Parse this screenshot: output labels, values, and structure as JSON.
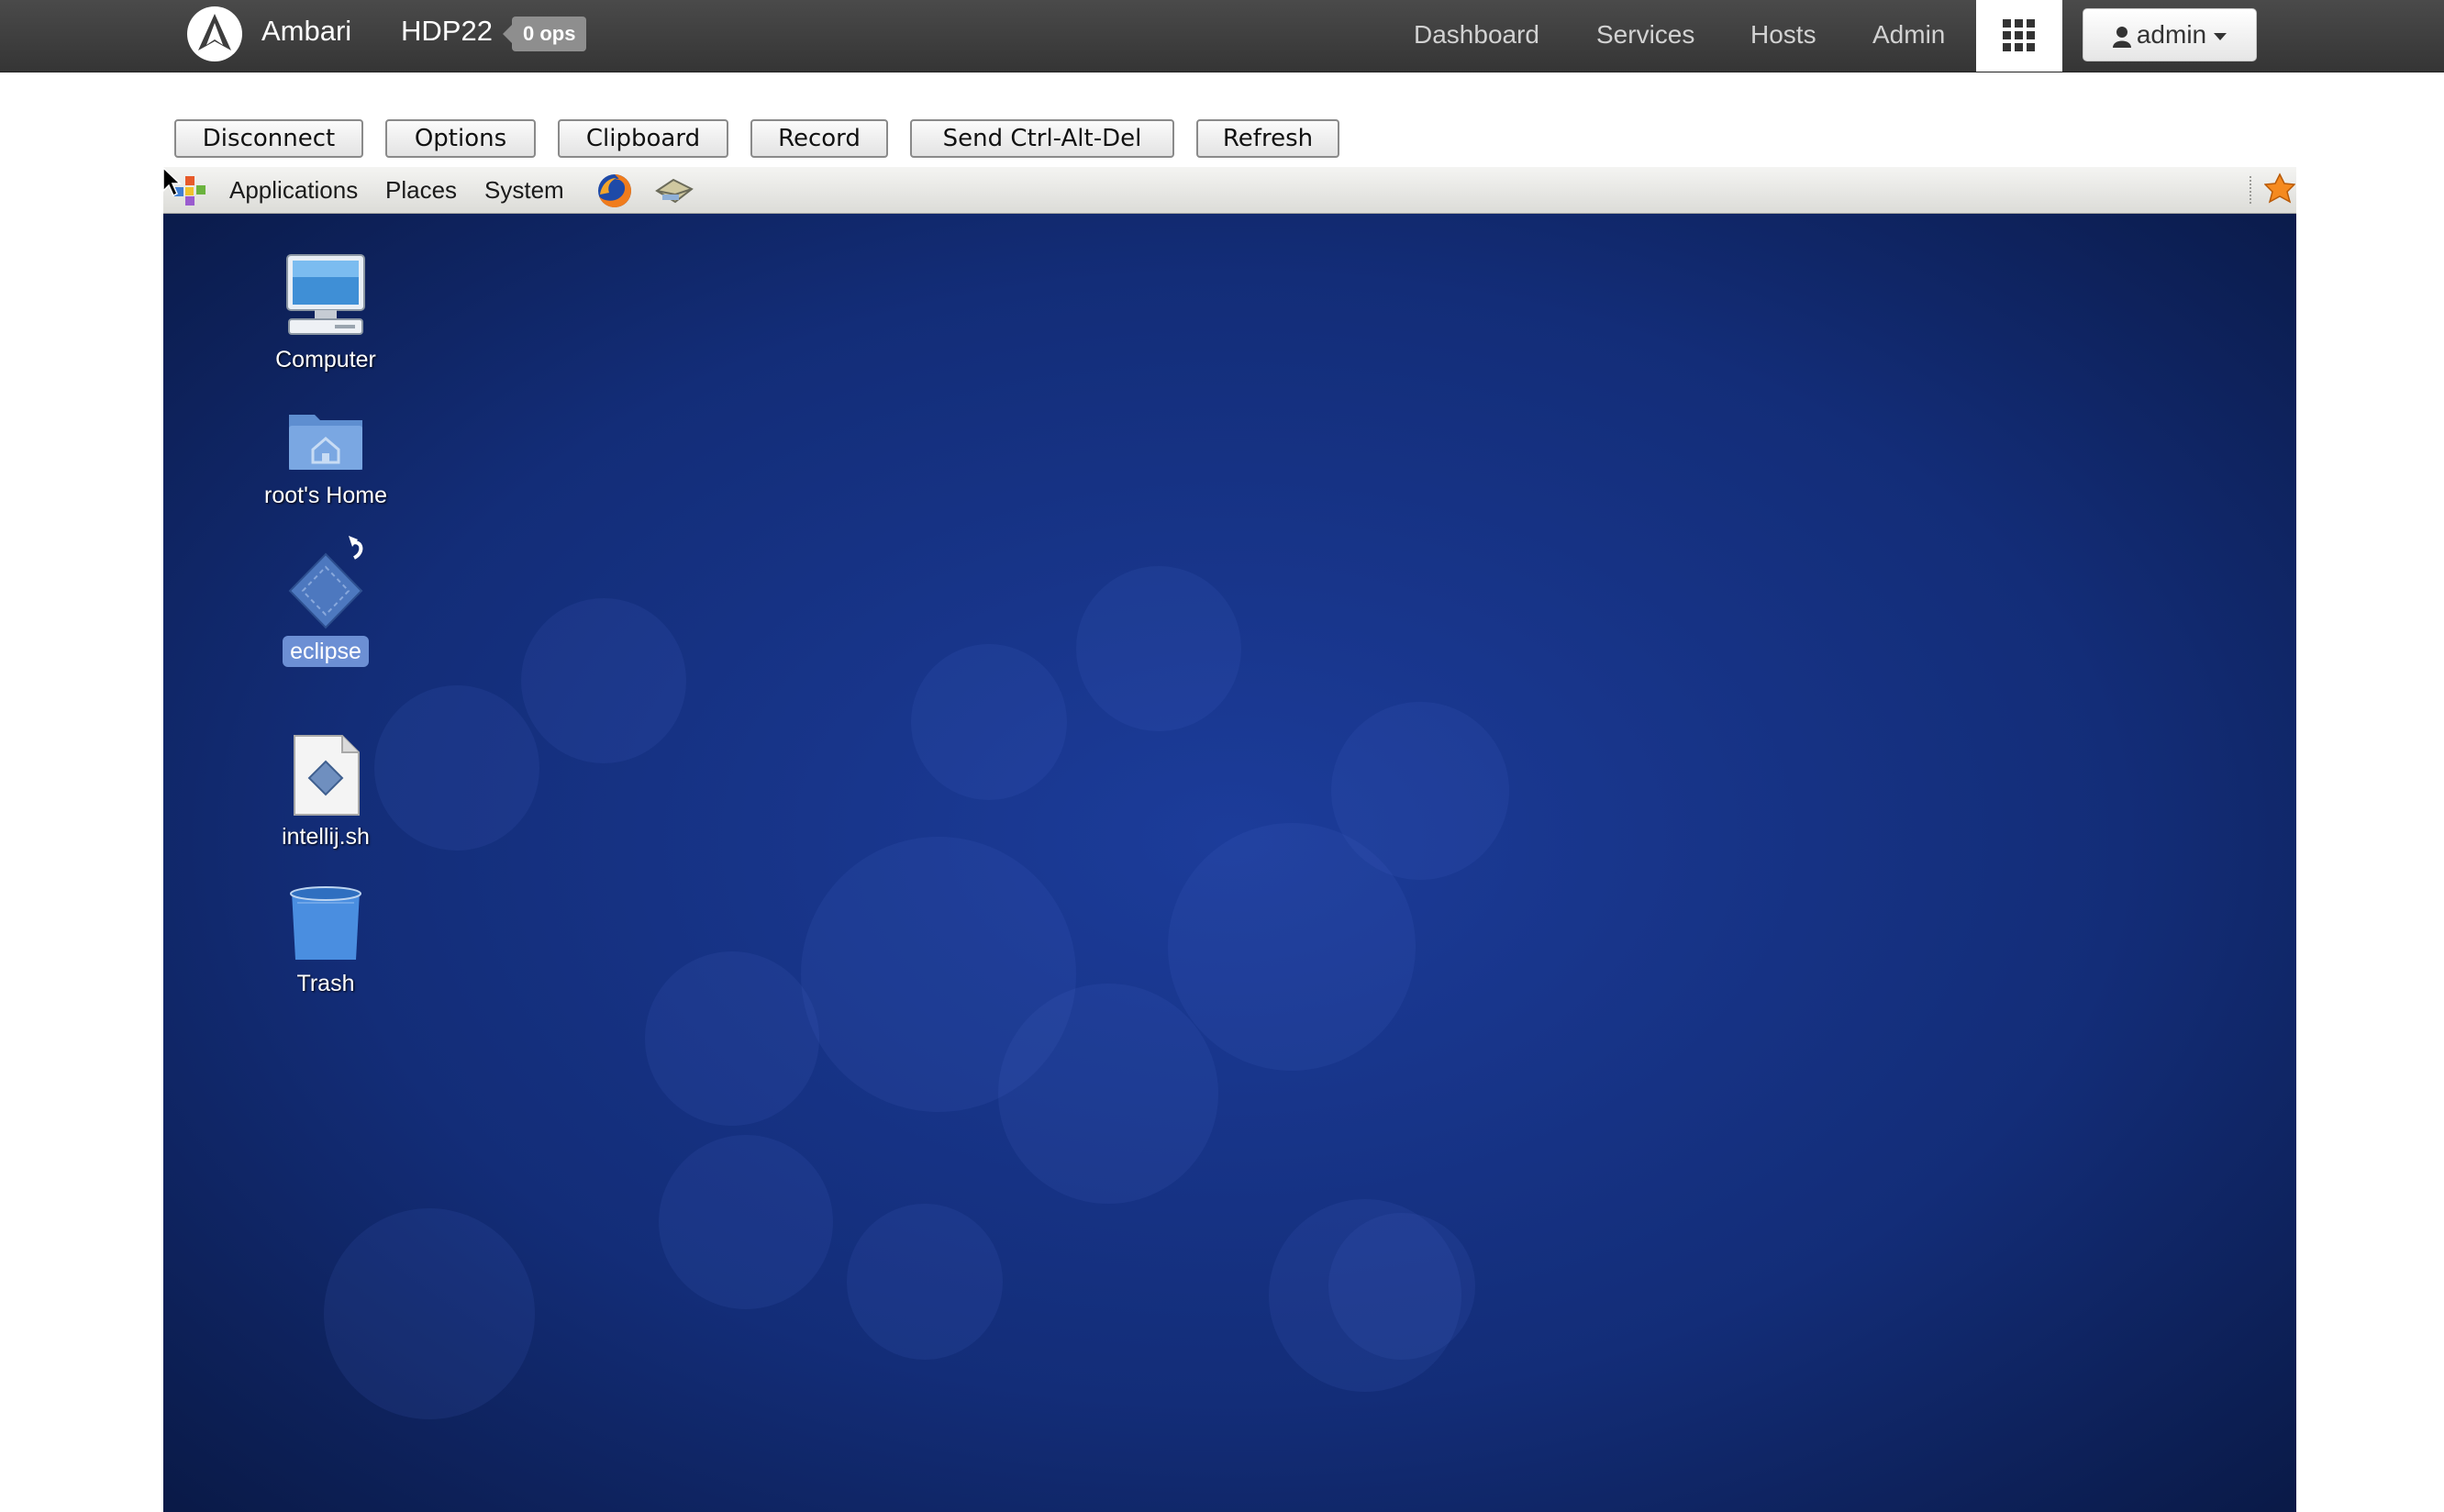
{
  "navbar": {
    "brand": "Ambari",
    "cluster": "HDP22",
    "ops_badge": "0 ops",
    "links": [
      "Dashboard",
      "Services",
      "Hosts",
      "Admin"
    ],
    "views_icon": "grid-icon",
    "user_menu": "admin"
  },
  "vnc_toolbar": {
    "buttons": [
      "Disconnect",
      "Options",
      "Clipboard",
      "Record",
      "Send Ctrl-Alt-Del",
      "Refresh"
    ]
  },
  "desktop": {
    "panel": {
      "menus": [
        "Applications",
        "Places",
        "System"
      ],
      "launchers": [
        "firefox-icon",
        "mail-icon"
      ]
    },
    "icons": [
      {
        "label": "Computer",
        "icon": "computer-icon"
      },
      {
        "label": "root's Home",
        "icon": "home-folder-icon"
      },
      {
        "label": "eclipse",
        "icon": "eclipse-link-icon",
        "selected": true
      },
      {
        "label": "intellij.sh",
        "icon": "script-file-icon"
      },
      {
        "label": "Trash",
        "icon": "trash-icon"
      }
    ]
  },
  "colors": {
    "navbar": "#3d3d3d",
    "desktop_background": "#0f2766",
    "selection": "#6c8fd4"
  }
}
